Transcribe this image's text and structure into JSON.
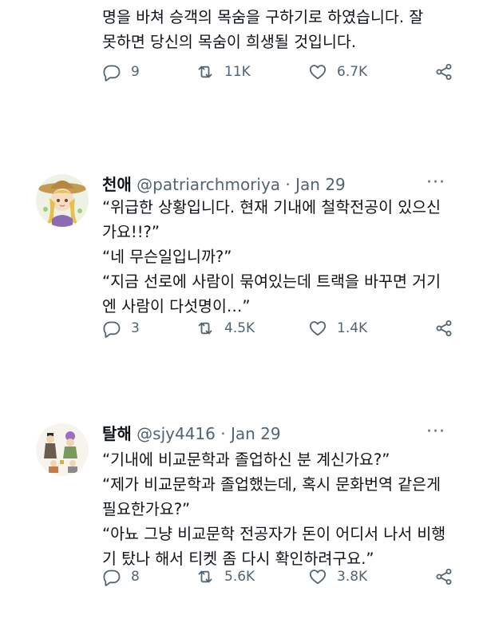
{
  "tweet0": {
    "body": [
      "명을 바쳐 승객의 목숨을 구하기로 하였습니다. 잘",
      "못하면 당신의 목숨이 희생될 것입니다."
    ],
    "replies": "9",
    "retweets": "11K",
    "likes": "6.7K"
  },
  "tweet1": {
    "name": "천애",
    "handle": "@patriarchmoriya",
    "sep": "·",
    "date": "Jan 29",
    "body": [
      "“위급한 상황입니다. 현재 기내에 철학전공이 있으신",
      "가요!!?”",
      "“네 무슨일입니까?”",
      "“지금 선로에 사람이 묶여있는데 트랙을 바꾸면 거기",
      "엔 사람이 다섯명이…”"
    ],
    "replies": "3",
    "retweets": "4.5K",
    "likes": "1.4K"
  },
  "tweet2": {
    "name": "탈해",
    "handle": "@sjy4416",
    "sep": "·",
    "date": "Jan 29",
    "body": [
      "“기내에 비교문학과 졸업하신 분 계신가요?”",
      "“제가 비교문학과 졸업했는데, 혹시 문화번역 같은게",
      "필요한가요?”",
      "“아뇨 그냥 비교문학 전공자가 돈이 어디서 나서 비행",
      "기 탔나 해서 티켓 좀 다시 확인하려구요.”"
    ],
    "replies": "8",
    "retweets": "5.6K",
    "likes": "3.8K"
  },
  "icons": {
    "reply": "reply-icon",
    "retweet": "retweet-icon",
    "like": "heart-icon",
    "share": "share-icon",
    "more": "more-icon"
  },
  "colors": {
    "text": "#0f1419",
    "secondary": "#536471"
  }
}
